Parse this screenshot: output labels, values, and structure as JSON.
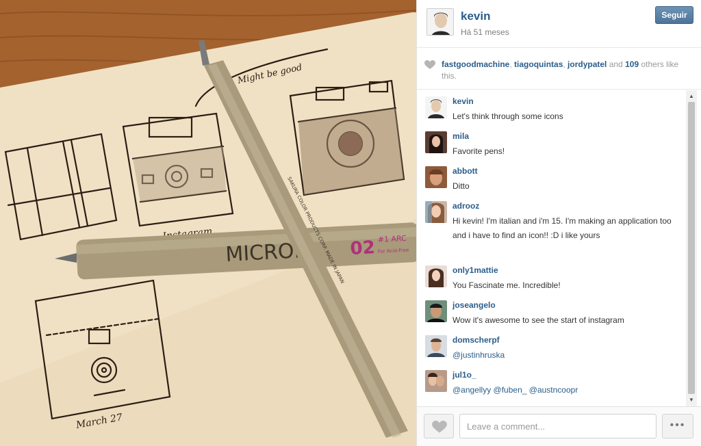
{
  "photo": {
    "handwritten": {
      "note": "Might be good",
      "label_instagram": "Instagram",
      "label_date": "March 27"
    },
    "pen_print": {
      "brand": "MICRON",
      "size": "02",
      "tip": "#1 ARC",
      "sub": "For Acid-Free",
      "side": "SAKURA COLOR PRODUCTS CORP. MADE IN JAPAN"
    }
  },
  "post": {
    "owner": "kevin",
    "timestamp": "Há 51 meses",
    "follow_label": "Seguir",
    "likes": {
      "users": [
        "fastgoodmachine",
        "tiagoquintas",
        "jordypatel"
      ],
      "sep": ", ",
      "and_text": " and ",
      "count": "109",
      "tail": " others like this."
    }
  },
  "comments": [
    {
      "user": "kevin",
      "text": "Let's think through some icons"
    },
    {
      "user": "mila",
      "text": "Favorite pens!"
    },
    {
      "user": "abbott",
      "text": "Ditto"
    },
    {
      "user": "adrooz",
      "text": "Hi kevin! I'm italian and i'm 15. I'm making an application too and i have to find an icon!! :D i like yours"
    },
    {
      "user": "only1mattie",
      "text": "You Fascinate me. Incredible!"
    },
    {
      "user": "joseangelo",
      "text": "Wow it's awesome to see the start of instagram"
    },
    {
      "user": "domscherpf",
      "text": "@justinhruska"
    },
    {
      "user": "jul1o_",
      "text": "@angellyy @fuben_ @austncoopr"
    }
  ],
  "composer": {
    "placeholder": "Leave a comment...",
    "more_label": "•••"
  },
  "scrollbar": {
    "up": "▲",
    "down": "▼"
  },
  "icons": {
    "like_small": "heart-icon",
    "like_button": "heart-icon",
    "more": "ellipsis-icon"
  },
  "colors": {
    "link": "#2b5d8a",
    "follow_button": "#5a80a6",
    "muted": "#9a9a9a"
  }
}
